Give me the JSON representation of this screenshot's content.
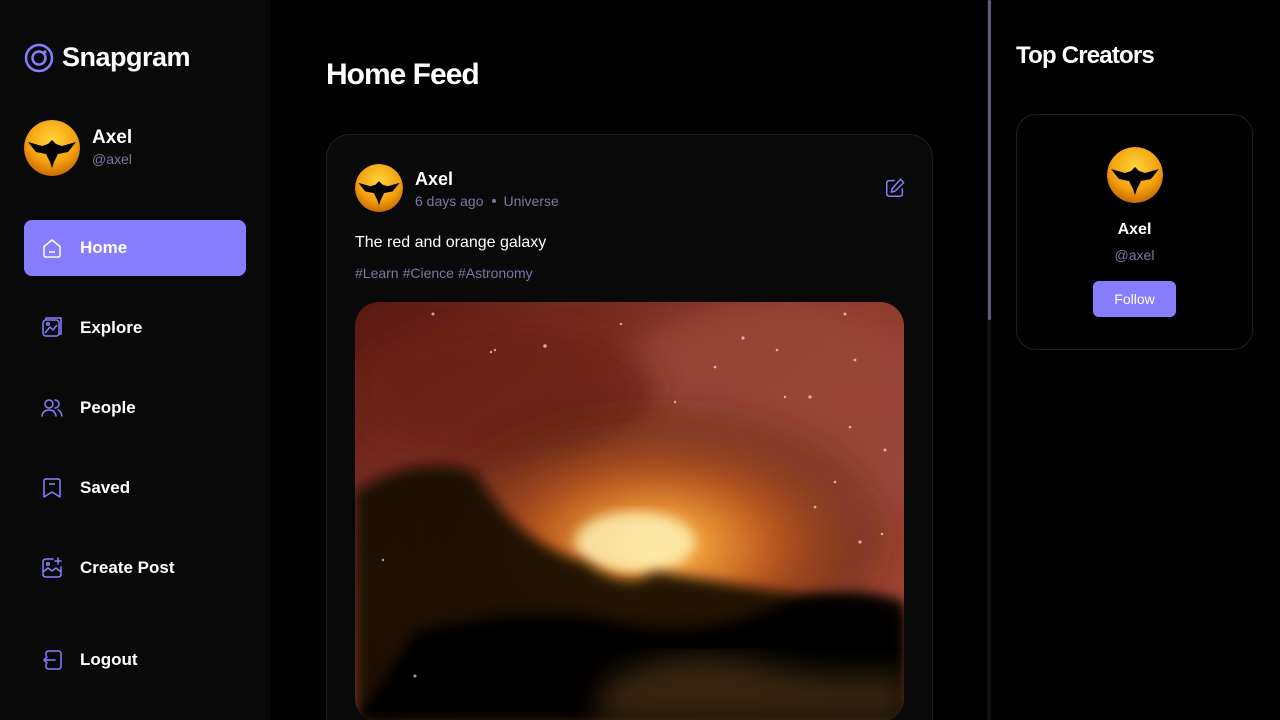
{
  "app": {
    "name": "Snapgram"
  },
  "user": {
    "name": "Axel",
    "handle": "@axel"
  },
  "nav": {
    "items": [
      {
        "label": "Home",
        "icon": "home-icon",
        "active": true
      },
      {
        "label": "Explore",
        "icon": "explore-icon"
      },
      {
        "label": "People",
        "icon": "people-icon"
      },
      {
        "label": "Saved",
        "icon": "bookmark-icon"
      },
      {
        "label": "Create Post",
        "icon": "image-add-icon"
      }
    ],
    "logout_label": "Logout"
  },
  "feed": {
    "title": "Home Feed",
    "post": {
      "author": "Axel",
      "time": "6 days ago",
      "location": "Universe",
      "caption": "The red and orange galaxy",
      "tags": [
        "#Learn",
        "#Cience",
        "#Astronomy"
      ]
    }
  },
  "top_creators": {
    "title": "Top Creators",
    "creators": [
      {
        "name": "Axel",
        "handle": "@axel",
        "button": "Follow"
      }
    ]
  },
  "colors": {
    "accent": "#877eff",
    "muted": "#7878a3",
    "sidebar_bg": "#09090a"
  }
}
